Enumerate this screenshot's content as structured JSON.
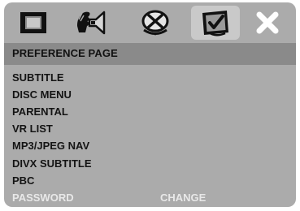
{
  "toolbar": {
    "tabs": [
      {
        "icon": "screen-setup-icon"
      },
      {
        "icon": "audio-setup-icon"
      },
      {
        "icon": "disc-settings-icon"
      },
      {
        "icon": "preference-checklist-icon"
      },
      {
        "icon": "close-icon"
      }
    ],
    "active_tab": 3
  },
  "page": {
    "title": "PREFERENCE PAGE"
  },
  "menu": {
    "items": [
      {
        "label": "SUBTITLE"
      },
      {
        "label": "DISC MENU"
      },
      {
        "label": "PARENTAL"
      },
      {
        "label": "VR LIST"
      },
      {
        "label": "MP3/JPEG NAV"
      },
      {
        "label": "DIVX SUBTITLE"
      },
      {
        "label": "PBC"
      },
      {
        "label": "PASSWORD",
        "value": "CHANGE",
        "state": "disabled"
      }
    ]
  },
  "colors": {
    "panel": "#ababab",
    "header_bar": "#8a8a8a",
    "text": "#141414",
    "disabled_text": "#e8e8e8"
  }
}
